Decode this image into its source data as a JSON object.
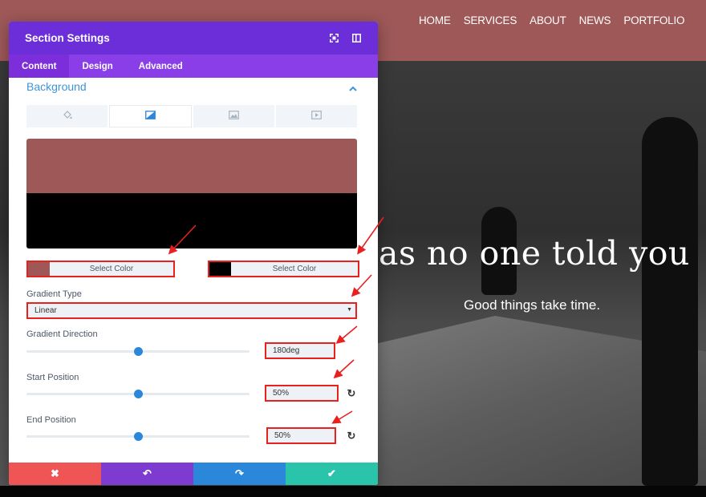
{
  "site": {
    "nav": [
      "HOME",
      "SERVICES",
      "ABOUT",
      "NEWS",
      "PORTFOLIO"
    ],
    "hero_headline": "as no one told you",
    "hero_subline": "Good things take time."
  },
  "modal": {
    "title": "Section Settings",
    "tabs": [
      {
        "label": "Content",
        "active": true
      },
      {
        "label": "Design",
        "active": false
      },
      {
        "label": "Advanced",
        "active": false
      }
    ],
    "section_title": "Background",
    "background_tabs": [
      "paint-bucket-icon",
      "gradient-icon",
      "image-icon",
      "video-icon"
    ],
    "gradient_preview": {
      "color_top": "#9e5858",
      "color_bottom": "#000000"
    },
    "color_pickers": [
      {
        "label": "Select Color",
        "color": "#9e5858"
      },
      {
        "label": "Select Color",
        "color": "#000000"
      }
    ],
    "gradient_type": {
      "label": "Gradient Type",
      "value": "Linear"
    },
    "gradient_direction": {
      "label": "Gradient Direction",
      "value": "180deg",
      "slider_fraction": 0.5
    },
    "start_position": {
      "label": "Start Position",
      "value": "50%",
      "slider_fraction": 0.5
    },
    "end_position": {
      "label": "End Position",
      "value": "50%",
      "slider_fraction": 0.5
    },
    "footer_buttons": [
      {
        "name": "close",
        "icon": "✖",
        "color": "#ef5555"
      },
      {
        "name": "undo",
        "icon": "↶",
        "color": "#7e3bd0"
      },
      {
        "name": "redo",
        "icon": "↷",
        "color": "#2b87da"
      },
      {
        "name": "save",
        "icon": "✔",
        "color": "#29c4a9"
      }
    ]
  },
  "colors": {
    "header_purple": "#6c2ed9",
    "tabs_purple": "#8a3ee8",
    "accent_blue": "#2b87da",
    "annotation_red": "#e8201e"
  }
}
